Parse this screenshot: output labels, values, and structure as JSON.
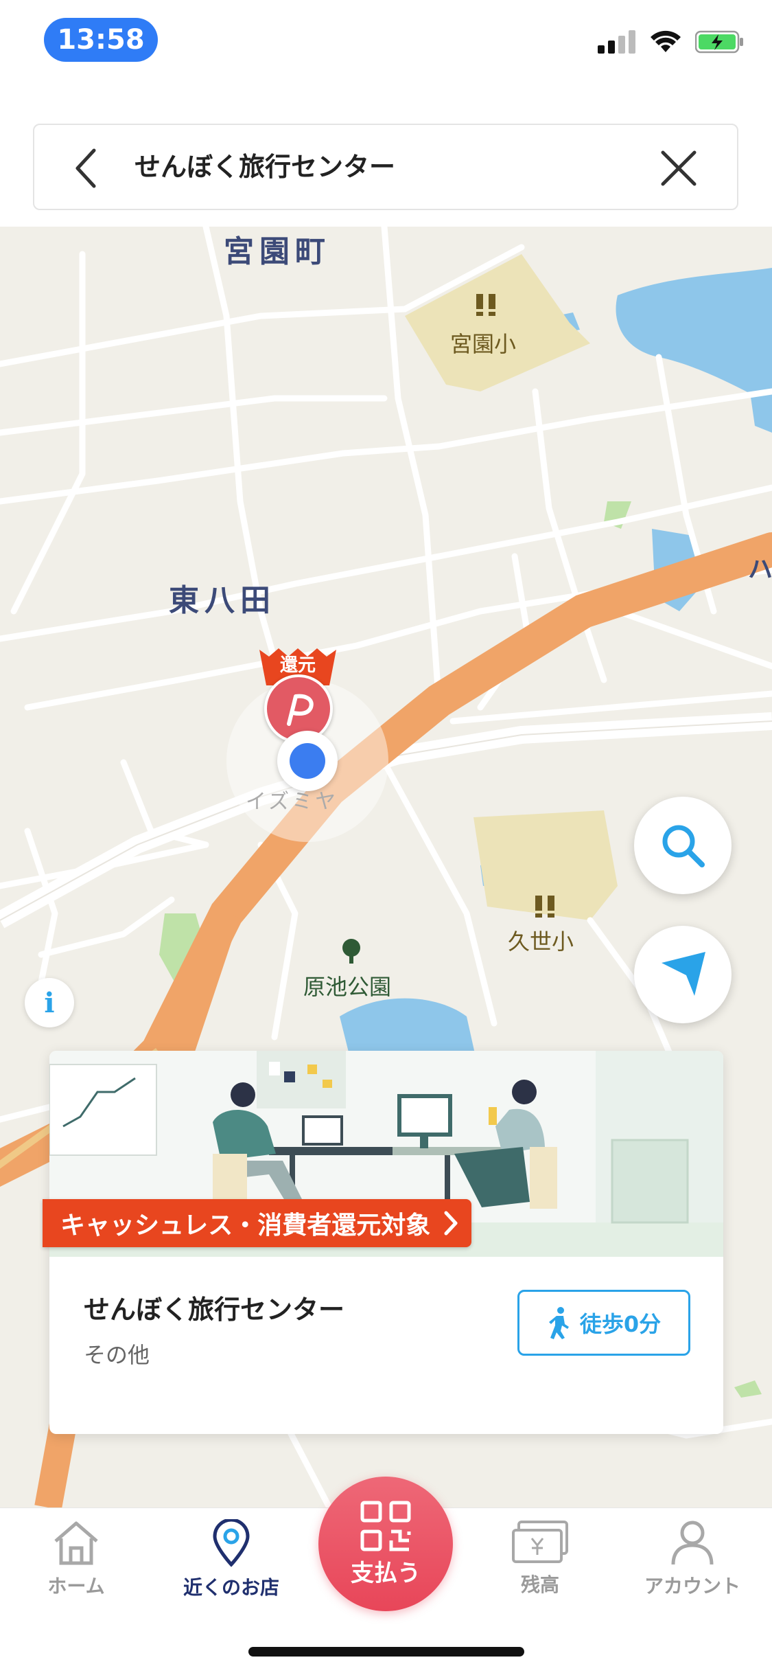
{
  "status_bar": {
    "time": "13:58",
    "icons": [
      "signal-icon",
      "wifi-icon",
      "battery-charging-icon"
    ]
  },
  "search": {
    "query": "せんぼく旅行センター",
    "back_icon": "chevron-left-icon",
    "clear_icon": "close-icon"
  },
  "map": {
    "labels": {
      "area_top": "宮園町",
      "area_mid": "東八田",
      "school_1": "宮園小",
      "school_2": "久世小",
      "park": "原池公園",
      "shop": "イズミヤ",
      "edge_right": "ハ"
    },
    "badge": "還元",
    "buttons": [
      "search-icon",
      "navigation-arrow-icon",
      "info-icon"
    ],
    "colors": {
      "highway": "#f0a468",
      "water": "#8ec6ea",
      "school_area": "#ece3b8",
      "land": "#f1efe8"
    }
  },
  "card": {
    "promo": "キャッシュレス・消費者還元対象",
    "store_name": "せんぼく旅行センター",
    "category": "その他",
    "walk_time": "徒歩0分"
  },
  "tab_bar": {
    "items": [
      {
        "label": "ホーム",
        "icon": "home-icon",
        "active": false
      },
      {
        "label": "近くのお店",
        "icon": "location-pin-icon",
        "active": true
      },
      {
        "label": "残高",
        "icon": "balance-icon",
        "active": false
      },
      {
        "label": "アカウント",
        "icon": "account-icon",
        "active": false
      }
    ],
    "pay": {
      "label": "支払う",
      "icon": "qr-code-icon"
    },
    "colors": {
      "pay": "#e84659",
      "active": "#1f2f6e"
    }
  }
}
